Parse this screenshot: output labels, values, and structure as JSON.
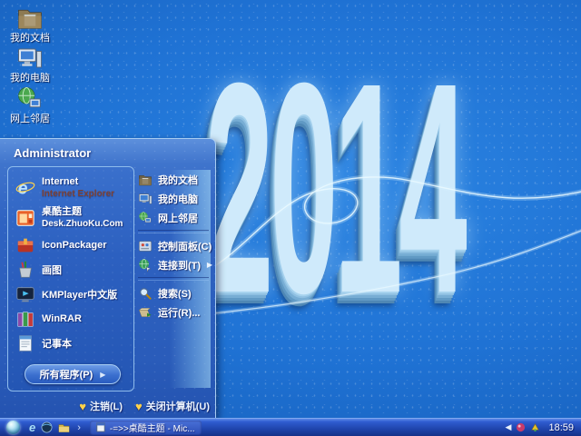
{
  "desktop": {
    "wallpaper_text": "2014",
    "icons": [
      {
        "label": "我的文档"
      },
      {
        "label": "我的电脑"
      },
      {
        "label": "网上邻居"
      }
    ]
  },
  "start_menu": {
    "user_name": "Administrator",
    "left_items": [
      {
        "title": "Internet",
        "subtitle": "Internet Explorer"
      },
      {
        "title": "桌酷主题",
        "subtitle": "Desk.ZhuoKu.Com"
      },
      {
        "title": "IconPackager"
      },
      {
        "title": "画图"
      },
      {
        "title": "KMPlayer中文版"
      },
      {
        "title": "WinRAR"
      },
      {
        "title": "记事本"
      }
    ],
    "right_items": [
      {
        "label": "我的文档"
      },
      {
        "label": "我的电脑"
      },
      {
        "label": "网上邻居"
      },
      {
        "label": "控制面板(C)"
      },
      {
        "label": "连接到(T)"
      },
      {
        "label": "搜索(S)"
      },
      {
        "label": "运行(R)..."
      }
    ],
    "all_programs_label": "所有程序(P)",
    "log_off_label": "注销(L)",
    "shutdown_label": "关闭计算机(U)"
  },
  "taskbar": {
    "task_button_label": "-=>>桌酷主题 - Mic...",
    "tray_clock": "18:59"
  },
  "icons_glyphs": {
    "submenu_arrow": "▶",
    "all_programs_arrow": "▶",
    "quicklaunch_chevron": "›",
    "tray_collapse": "◀",
    "heart": "♥",
    "ie_letter": "e"
  },
  "colors": {
    "desktop_blue": "#1f72d4",
    "menu_frame_blue": "#2f63c2",
    "left_panel_blue": "#2c60c0",
    "taskbar_top": "#5d8ae8",
    "taskbar_bottom": "#153188",
    "ice_text": "#cfeafb",
    "accent_yellow": "#ffd24a",
    "subtitle_maroon": "#7c4034"
  }
}
